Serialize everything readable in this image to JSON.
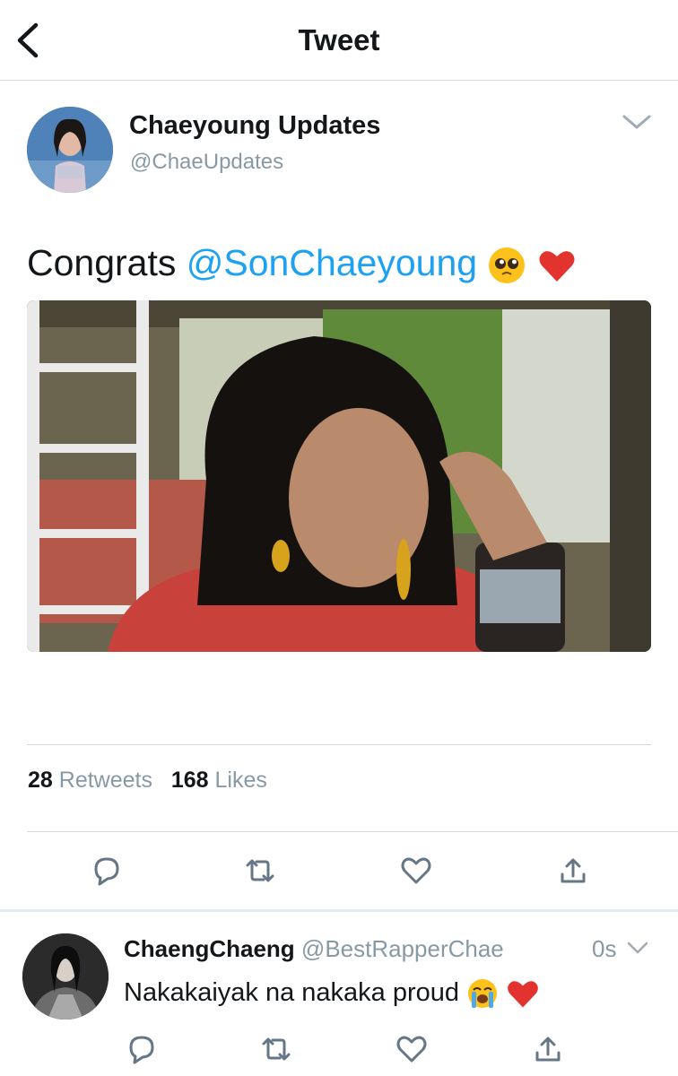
{
  "nav": {
    "title": "Tweet",
    "back_icon": "chevron-left-icon"
  },
  "tweet": {
    "author_name": "Chaeyoung Updates",
    "author_handle": "@ChaeUpdates",
    "text_before": "Congrats ",
    "mention": "@SonChaeyoung",
    "emojis": [
      "pleading-face-emoji",
      "red-heart-emoji"
    ],
    "retweet_count": "28",
    "retweets_label": "Retweets",
    "like_count": "168",
    "likes_label": "Likes",
    "actions": [
      "reply-icon",
      "retweet-icon",
      "like-icon",
      "share-icon"
    ]
  },
  "reply": {
    "author_name": "ChaengChaeng",
    "author_handle": "@BestRapperChae",
    "time": "0s",
    "text": "Nakakaiyak na nakaka proud",
    "emojis": [
      "loudly-crying-face-emoji",
      "red-heart-emoji"
    ],
    "actions": [
      "reply-icon",
      "retweet-icon",
      "like-icon",
      "share-icon"
    ]
  },
  "colors": {
    "link": "#1da1f2",
    "secondary": "#8899a6",
    "heart": "#e0245e",
    "divider": "#d6d9dc"
  }
}
